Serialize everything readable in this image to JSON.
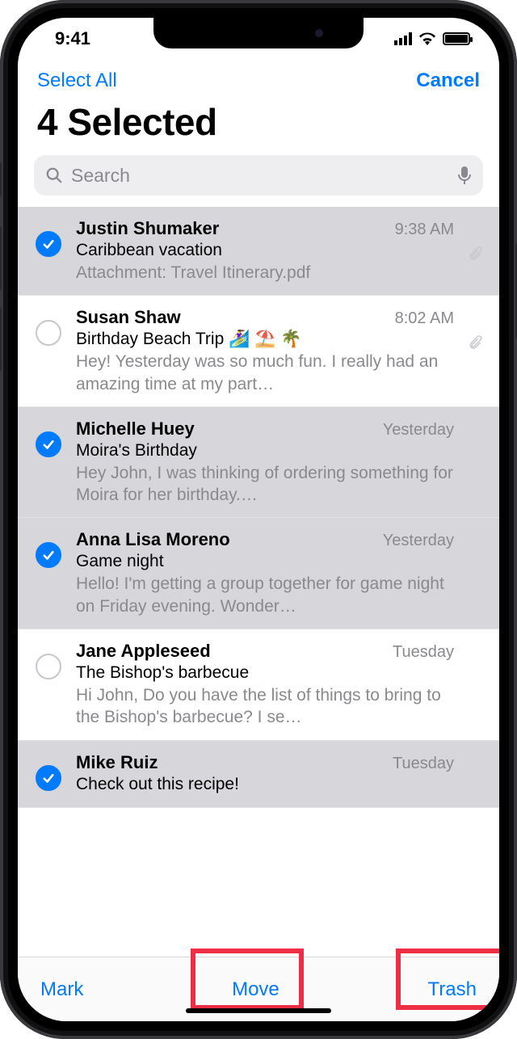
{
  "status": {
    "time": "9:41"
  },
  "nav": {
    "select_all": "Select All",
    "cancel": "Cancel"
  },
  "title": "4 Selected",
  "search": {
    "placeholder": "Search"
  },
  "toolbar": {
    "mark": "Mark",
    "move": "Move",
    "trash": "Trash"
  },
  "emails": [
    {
      "sender": "Justin Shumaker",
      "time": "9:38 AM",
      "subject": "Caribbean vacation",
      "preview": "Attachment: Travel Itinerary.pdf",
      "selected": true,
      "attachment": true
    },
    {
      "sender": "Susan Shaw",
      "time": "8:02 AM",
      "subject": "Birthday Beach Trip 🏄‍♀️ ⛱️ 🌴",
      "preview": "Hey! Yesterday was so much fun. I really had an amazing time at my part…",
      "selected": false,
      "attachment": true
    },
    {
      "sender": "Michelle Huey",
      "time": "Yesterday",
      "subject": "Moira's Birthday",
      "preview": "Hey John, I was thinking of ordering something for Moira for her birthday.…",
      "selected": true,
      "attachment": false
    },
    {
      "sender": "Anna Lisa Moreno",
      "time": "Yesterday",
      "subject": "Game night",
      "preview": "Hello! I'm getting a group together for game night on Friday evening. Wonder…",
      "selected": true,
      "attachment": false
    },
    {
      "sender": "Jane Appleseed",
      "time": "Tuesday",
      "subject": "The Bishop's barbecue",
      "preview": "Hi John, Do you have the list of things to bring to the Bishop's barbecue? I se…",
      "selected": false,
      "attachment": false
    },
    {
      "sender": "Mike Ruiz",
      "time": "Tuesday",
      "subject": "Check out this recipe!",
      "preview": "",
      "selected": true,
      "attachment": false
    }
  ]
}
